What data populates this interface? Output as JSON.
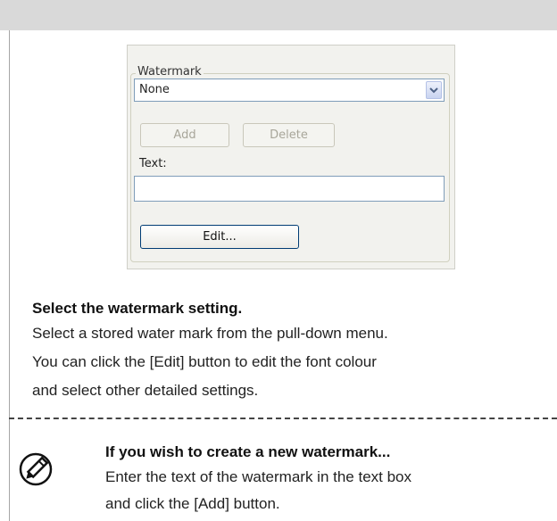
{
  "dialog": {
    "group_label": "Watermark",
    "select_value": "None",
    "add_button": "Add",
    "delete_button": "Delete",
    "text_label": "Text:",
    "text_value": "",
    "edit_button": "Edit..."
  },
  "instructions": {
    "heading": "Select the watermark setting.",
    "lines": [
      "Select a stored water mark from the pull-down menu.",
      "You can click the [Edit] button to edit the font colour",
      "and select other detailed settings."
    ]
  },
  "note": {
    "title": "If you wish to create a new watermark...",
    "lines": [
      "Enter the text of the watermark in the text box",
      "and click the [Add] button."
    ],
    "icon": "pencil-icon"
  }
}
